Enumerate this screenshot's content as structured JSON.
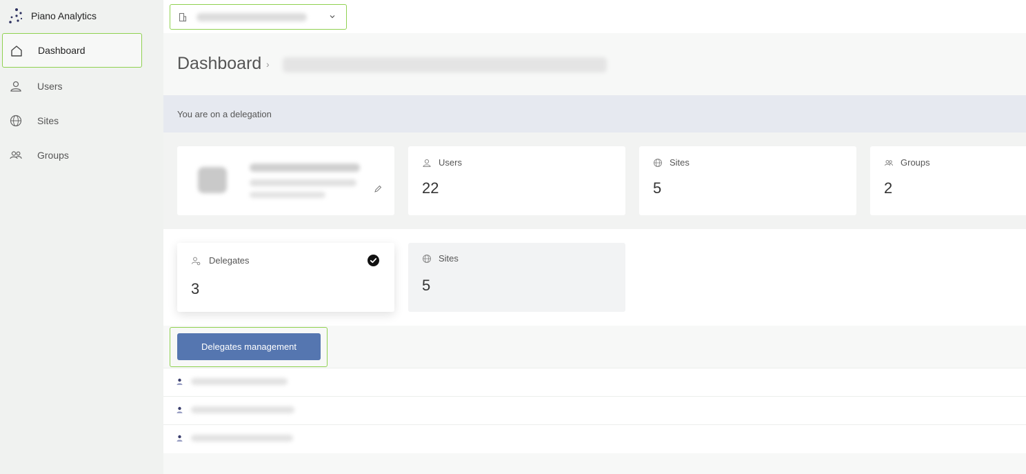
{
  "app": {
    "name": "Piano Analytics"
  },
  "sidebar": {
    "items": [
      {
        "label": "Dashboard",
        "icon": "home-icon",
        "active": true
      },
      {
        "label": "Users",
        "icon": "user-icon",
        "active": false
      },
      {
        "label": "Sites",
        "icon": "globe-icon",
        "active": false
      },
      {
        "label": "Groups",
        "icon": "users-icon",
        "active": false
      }
    ]
  },
  "header": {
    "organization_selector_icon": "building-icon",
    "dropdown_icon": "chevron-down-icon"
  },
  "page": {
    "title": "Dashboard",
    "separator": "›"
  },
  "banner": {
    "text": "You are on a delegation"
  },
  "stats": [
    {
      "label": "Users",
      "value": "22",
      "icon": "user-icon"
    },
    {
      "label": "Sites",
      "value": "5",
      "icon": "globe-icon"
    },
    {
      "label": "Groups",
      "value": "2",
      "icon": "users-icon"
    }
  ],
  "delegation_stats": [
    {
      "label": "Delegates",
      "value": "3",
      "icon": "delegate-icon",
      "selected": true
    },
    {
      "label": "Sites",
      "value": "5",
      "icon": "globe-icon",
      "selected": false
    }
  ],
  "actions": {
    "delegates_management": "Delegates management"
  },
  "colors": {
    "accent_outline": "#8fd14f",
    "primary_button": "#5576b0",
    "banner_bg": "#e6e9f0"
  }
}
